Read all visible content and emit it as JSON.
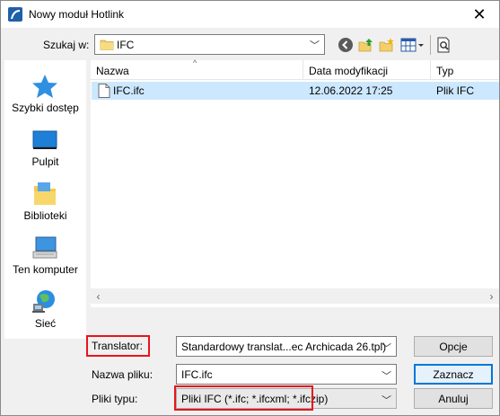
{
  "window": {
    "title": "Nowy moduł Hotlink"
  },
  "toolbar": {
    "look_in_label": "Szukaj w:",
    "look_in_value": "IFC"
  },
  "places": [
    {
      "label": "Szybki dostęp",
      "icon": "star-icon"
    },
    {
      "label": "Pulpit",
      "icon": "desktop-icon"
    },
    {
      "label": "Biblioteki",
      "icon": "libraries-icon"
    },
    {
      "label": "Ten komputer",
      "icon": "computer-icon"
    },
    {
      "label": "Sieć",
      "icon": "network-icon"
    }
  ],
  "file_list": {
    "columns": [
      "Nazwa",
      "Data modyfikacji",
      "Typ"
    ],
    "rows": [
      {
        "name": "IFC.ifc",
        "modified": "12.06.2022 17:25",
        "type": "Plik IFC",
        "selected": true
      }
    ]
  },
  "translator": {
    "label": "Translator:",
    "value": "Standardowy translat...ec Archicada 26.tpl)",
    "options_button": "Opcje"
  },
  "filename": {
    "label": "Nazwa pliku:",
    "value": "IFC.ifc",
    "action_button": "Zaznacz"
  },
  "filetype": {
    "label": "Pliki typu:",
    "value": "Pliki IFC (*.ifc; *.ifcxml; *.ifczip)",
    "cancel_button": "Anuluj"
  },
  "colors": {
    "highlight_box": "#e8141b",
    "selection": "#cce8ff",
    "default_button_border": "#0078d7"
  }
}
